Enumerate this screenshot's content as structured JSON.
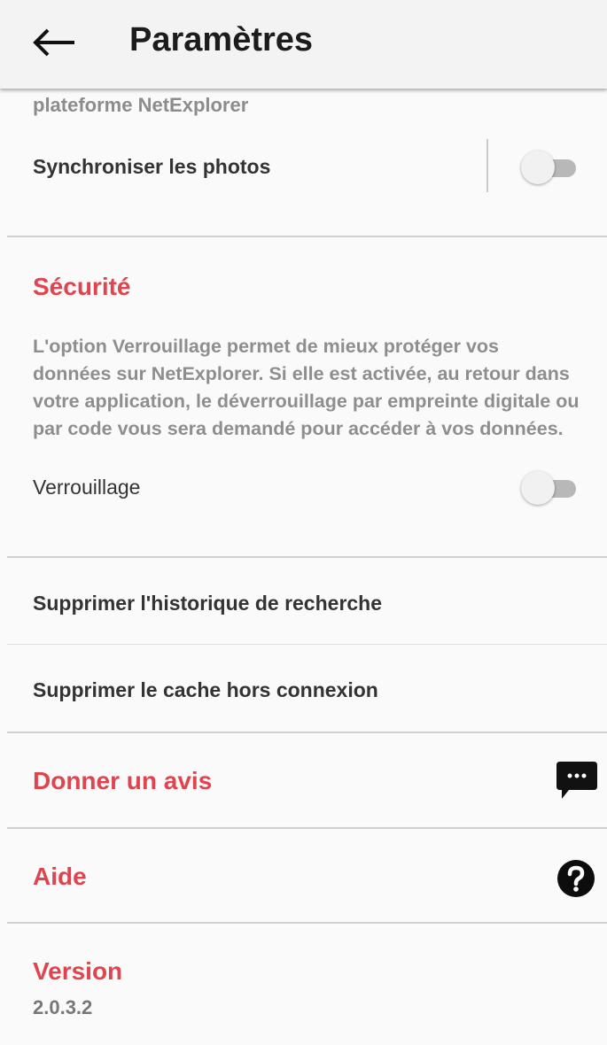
{
  "appbar": {
    "title": "Paramètres"
  },
  "sync": {
    "partial_text": "plateforme NetExplorer",
    "photos_label": "Synchroniser les photos",
    "photos_enabled": false
  },
  "security": {
    "title": "Sécurité",
    "description": "L'option Verrouillage permet de mieux protéger vos données sur NetExplorer. Si elle est activée, au retour dans votre application, le déverrouillage par empreinte digitale ou par code vous sera demandé pour accéder à vos données.",
    "lock_label": "Verrouillage",
    "lock_enabled": false
  },
  "actions": {
    "clear_history": "Supprimer l'historique de recherche",
    "clear_cache": "Supprimer le cache hors connexion"
  },
  "feedback": {
    "label": "Donner un avis"
  },
  "help": {
    "label": "Aide"
  },
  "version": {
    "title": "Version",
    "value": "2.0.3.2"
  },
  "colors": {
    "accent": "#e0444e",
    "muted": "#8e8e8e",
    "appbar": "#f3f3f3"
  },
  "icons": {
    "back": "arrow-left",
    "feedback": "chat-bubble-dots",
    "help": "question-circle"
  }
}
